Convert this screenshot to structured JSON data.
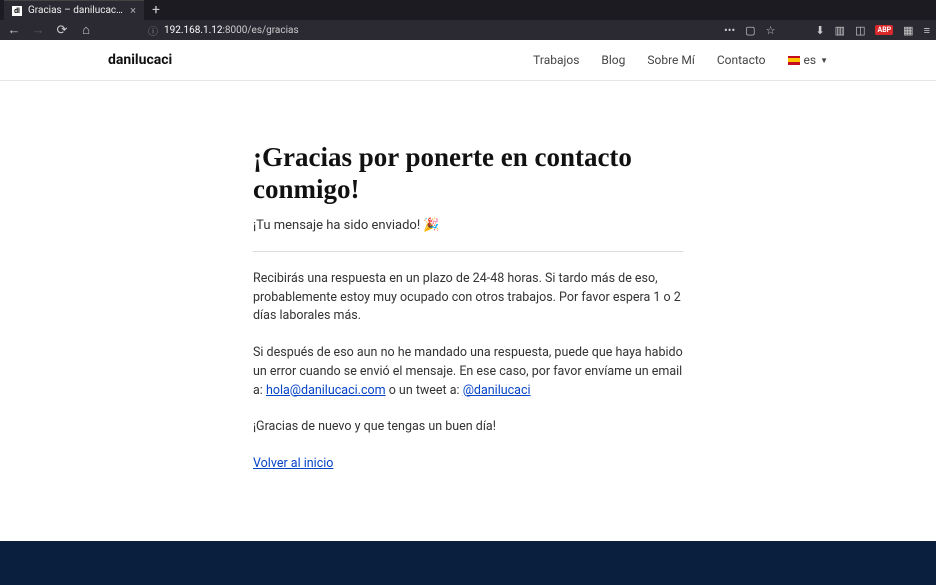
{
  "browser": {
    "tab": {
      "favicon": "dl",
      "title": "Gracias – danilucaci.com | Dise"
    },
    "url": {
      "host": "192.168.1.12",
      "rest": ":8000/es/gracias"
    }
  },
  "header": {
    "logo": "danilucaci",
    "nav": [
      "Trabajos",
      "Blog",
      "Sobre Mí",
      "Contacto"
    ],
    "lang": "es"
  },
  "content": {
    "title": "¡Gracias por ponerte en contacto conmigo!",
    "subtitle": "¡Tu mensaje ha sido enviado! 🎉",
    "p1": "Recibirás una respuesta en un plazo de 24-48 horas. Si tardo más de eso, probablemente estoy muy ocupado con otros trabajos. Por favor espera 1 o 2 días laborales más.",
    "p2_a": "Si después de eso aun no he mandado una respuesta, puede que haya habido un error cuando se envió el mensaje. En ese caso, por favor envíame un email a: ",
    "email": "hola@danilucaci.com",
    "p2_b": " o un tweet a: ",
    "twitter": "@danilucaci",
    "p3": "¡Gracias de nuevo y que tengas un buen día!",
    "back": "Volver al inicio"
  }
}
